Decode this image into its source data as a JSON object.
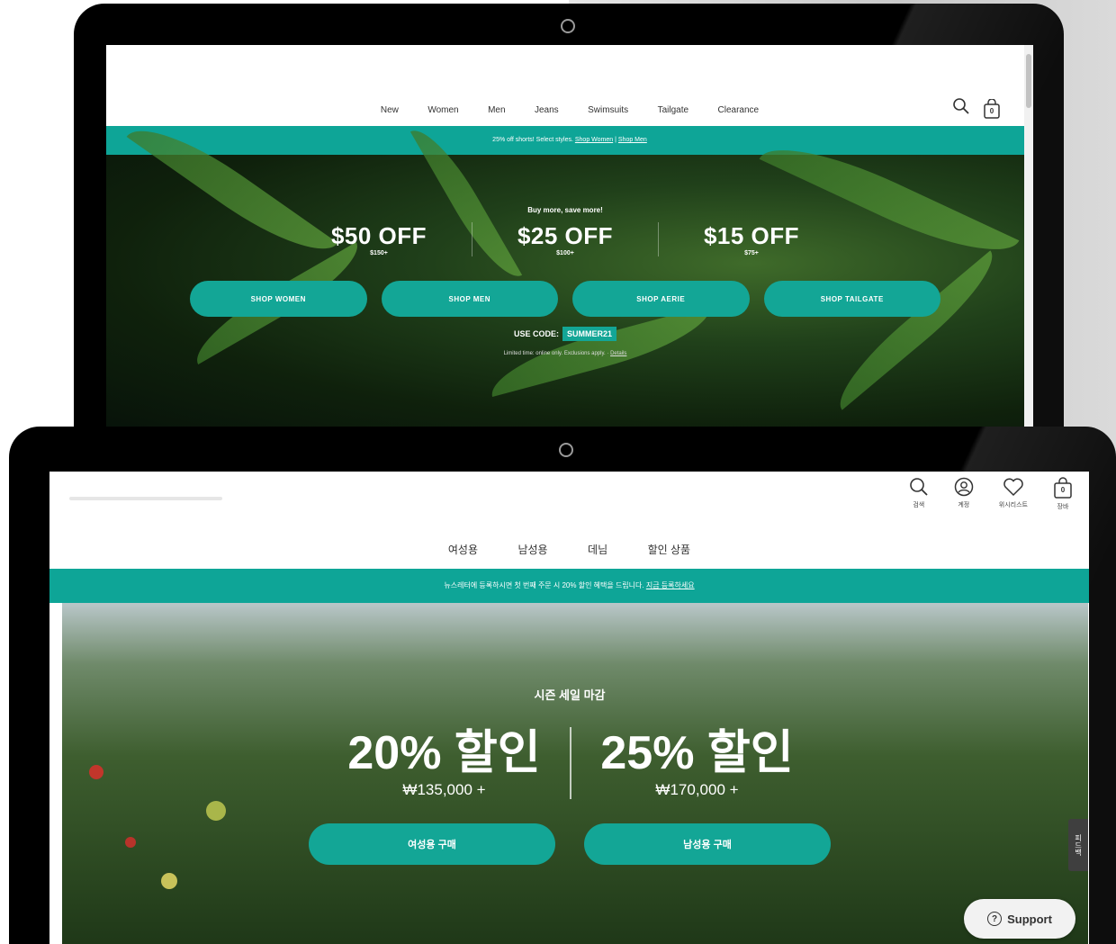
{
  "top_site": {
    "nav": [
      "New",
      "Women",
      "Men",
      "Jeans",
      "Swimsuits",
      "Tailgate",
      "Clearance"
    ],
    "icons": [
      "search-icon",
      "bag-icon"
    ],
    "bag_count": "0",
    "promo": {
      "text": "25% off shorts! Select styles.",
      "link_women": "Shop Women",
      "link_men": "Shop Men"
    },
    "hero": {
      "tagline": "Buy more, save more!",
      "offers": [
        {
          "amount": "$50 OFF",
          "min": "$150+"
        },
        {
          "amount": "$25 OFF",
          "min": "$100+"
        },
        {
          "amount": "$15 OFF",
          "min": "$75+"
        }
      ],
      "buttons": [
        "SHOP WOMEN",
        "SHOP MEN",
        "SHOP AERIE",
        "SHOP TAILGATE"
      ],
      "code_label": "USE CODE:",
      "code": "SUMMER21",
      "fine_print": "Limited time: online only. Exclusions apply.",
      "details_link": "Details"
    }
  },
  "bottom_site": {
    "icons": [
      {
        "name": "search-icon",
        "label": "검색"
      },
      {
        "name": "account-icon",
        "label": "계정"
      },
      {
        "name": "heart-icon",
        "label": "위시리스트"
      },
      {
        "name": "bag-icon",
        "label": "장바"
      }
    ],
    "bag_count": "0",
    "nav": [
      "여성용",
      "남성용",
      "데님",
      "할인 상품"
    ],
    "promo": {
      "text": "뉴스레터에 등록하시면 첫 번째 주문 시 20% 할인 혜택을 드립니다.",
      "link": "지금 등록하세요"
    },
    "hero": {
      "tagline": "시즌 세일 마감",
      "offers": [
        {
          "amount": "20% 할인",
          "min": "₩135,000 +"
        },
        {
          "amount": "25% 할인",
          "min": "₩170,000 +"
        }
      ],
      "buttons": [
        "여성용 구매",
        "남성용 구매"
      ]
    },
    "feedback_tab": "피드백",
    "support": "Support"
  },
  "colors": {
    "accent": "#13a696",
    "promo_bar": "#0ea597",
    "device_frame": "#000000"
  }
}
